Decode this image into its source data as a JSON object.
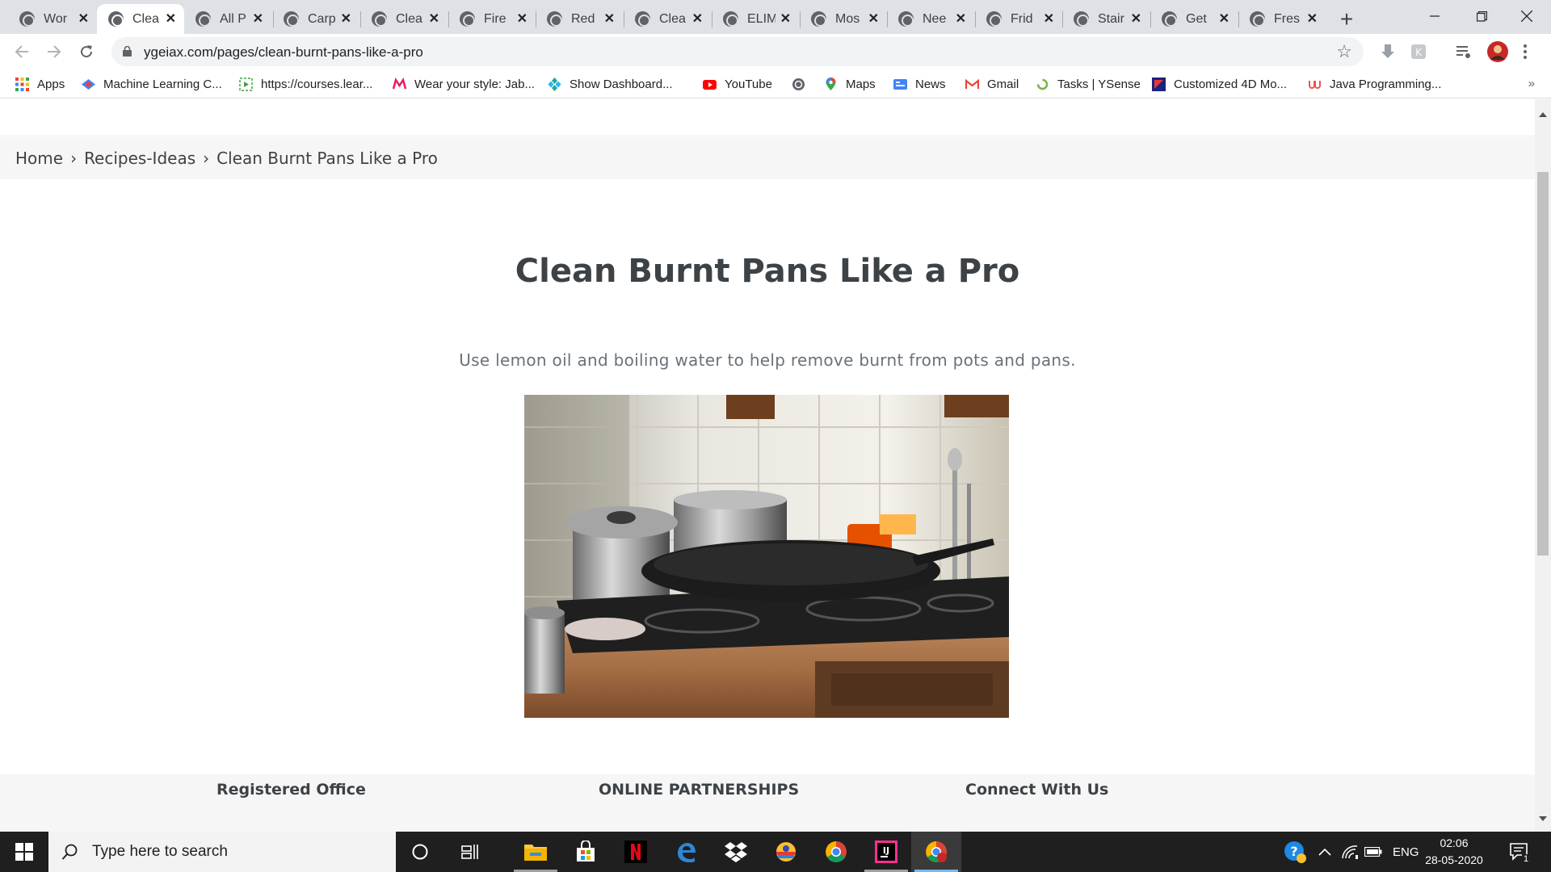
{
  "browser": {
    "tabs": [
      {
        "title": "Wor",
        "active": false
      },
      {
        "title": "Clea",
        "active": true
      },
      {
        "title": "All P",
        "active": false
      },
      {
        "title": "Carp",
        "active": false
      },
      {
        "title": "Clea",
        "active": false
      },
      {
        "title": "Fire",
        "active": false
      },
      {
        "title": "Red",
        "active": false
      },
      {
        "title": "Clea",
        "active": false
      },
      {
        "title": "ELIM",
        "active": false
      },
      {
        "title": "Mos",
        "active": false
      },
      {
        "title": "Nee",
        "active": false
      },
      {
        "title": "Frid",
        "active": false
      },
      {
        "title": "Stair",
        "active": false
      },
      {
        "title": "Get",
        "active": false
      },
      {
        "title": "Fres",
        "active": false
      }
    ],
    "url": "ygeiax.com/pages/clean-burnt-pans-like-a-pro",
    "bookmarks": [
      {
        "label": "Apps",
        "icon": "apps-grid-icon"
      },
      {
        "label": "Machine Learning C...",
        "icon": "ml-course-icon"
      },
      {
        "label": "https://courses.lear...",
        "icon": "courses-icon"
      },
      {
        "label": "Wear your style: Jab...",
        "icon": "myntra-icon"
      },
      {
        "label": "Show Dashboard...",
        "icon": "dashboard-icon"
      },
      {
        "label": "YouTube",
        "icon": "youtube-icon"
      },
      {
        "label": "",
        "icon": "globe-icon"
      },
      {
        "label": "Maps",
        "icon": "maps-pin-icon"
      },
      {
        "label": "News",
        "icon": "google-news-icon"
      },
      {
        "label": "Gmail",
        "icon": "gmail-icon"
      },
      {
        "label": "Tasks | YSense",
        "icon": "ysense-icon"
      },
      {
        "label": "Customized 4D Mo...",
        "icon": "4d-icon"
      },
      {
        "label": "Java Programming...",
        "icon": "udemy-icon"
      }
    ],
    "bookmarks_more": "»"
  },
  "page": {
    "breadcrumb": {
      "home": "Home",
      "sep": "›",
      "section": "Recipes-Ideas",
      "current": "Clean Burnt Pans Like a Pro"
    },
    "title": "Clean Burnt Pans Like a Pro",
    "description": "Use lemon oil and boiling water to help remove burnt from pots and pans.",
    "footer": {
      "col1": "Registered Office",
      "col2": "ONLINE PARTNERSHIPS",
      "col3": "Connect With Us"
    }
  },
  "taskbar": {
    "search_placeholder": "Type here to search",
    "language": "ENG",
    "time": "02:06",
    "date": "28-05-2020",
    "notification_count": "1",
    "apps": [
      "cortana-icon",
      "task-view-icon",
      "file-explorer-icon",
      "store-icon",
      "netflix-icon",
      "edge-icon",
      "dropbox-icon",
      "app-icon",
      "chrome-icon",
      "intellij-icon",
      "chrome-active-icon"
    ]
  },
  "colors": {
    "tabstrip": "#dee1e6",
    "title_text": "#3d4246",
    "desc_text": "#69727b",
    "breadcrumb_bg": "#f6f6f6",
    "taskbar": "#1f1f1f",
    "taskbar_accent": "#76b9ed"
  }
}
